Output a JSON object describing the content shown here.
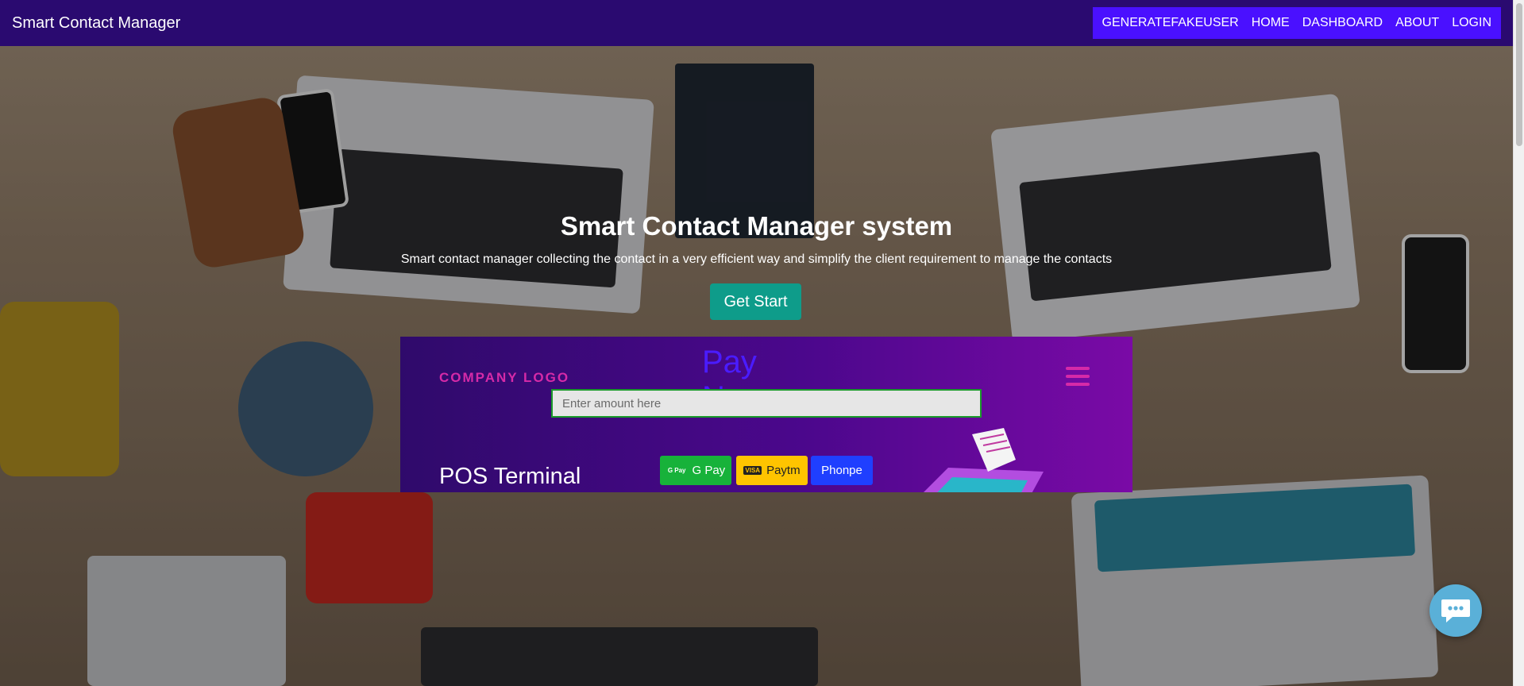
{
  "navbar": {
    "brand": "Smart Contact Manager",
    "links": [
      "GENERATEFAKEUSER",
      "HOME",
      "DASHBOARD",
      "ABOUT",
      "LOGIN"
    ]
  },
  "hero": {
    "title": "Smart Contact Manager system",
    "subtitle": "Smart contact manager collecting the contact in a very efficient way and simplify the client requirement to manage the contacts",
    "button": "Get Start"
  },
  "payment": {
    "company_logo": "COMPANY LOGO",
    "heading": "Pay Now",
    "amount_placeholder": "Enter amount here",
    "pos_title": "POS Terminal",
    "buttons": {
      "gpay": "G Pay",
      "gpay_badge": "G Pay",
      "paytm": "Paytm",
      "paytm_badge": "VISA",
      "phonpe": "Phonpe"
    }
  },
  "icons": {
    "chat": "chat-bubble-icon",
    "menu": "hamburger-menu-icon"
  },
  "colors": {
    "navbar": "#2a0a70",
    "nav_links_bg": "#4a10ff",
    "get_start": "#0e9c8a",
    "gpay": "#17b23a",
    "paytm": "#ffc400",
    "phonpe": "#1f3fff",
    "chat": "#5ab0d8"
  }
}
